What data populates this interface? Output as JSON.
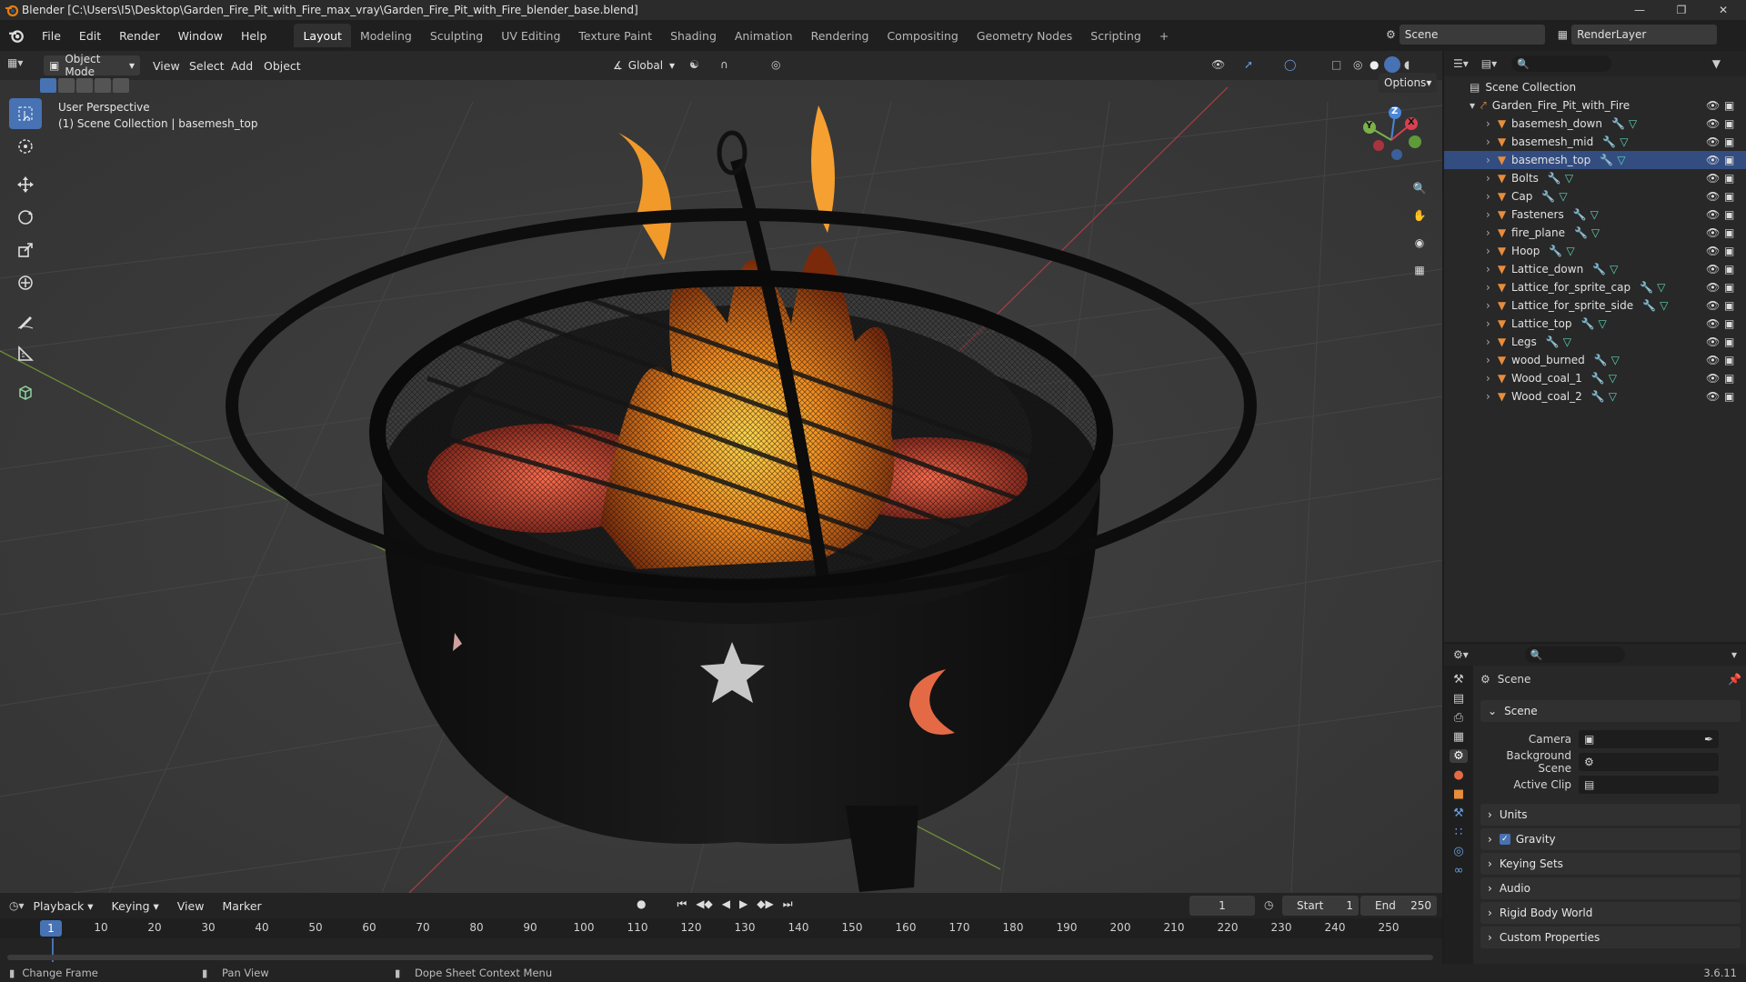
{
  "window": {
    "title": "Blender [C:\\Users\\I5\\Desktop\\Garden_Fire_Pit_with_Fire_max_vray\\Garden_Fire_Pit_with_Fire_blender_base.blend]"
  },
  "menu": [
    "File",
    "Edit",
    "Render",
    "Window",
    "Help"
  ],
  "workspaces": [
    "Layout",
    "Modeling",
    "Sculpting",
    "UV Editing",
    "Texture Paint",
    "Shading",
    "Animation",
    "Rendering",
    "Compositing",
    "Geometry Nodes",
    "Scripting"
  ],
  "top_right": {
    "scene": "Scene",
    "render_layer": "RenderLayer"
  },
  "viewport": {
    "mode": "Object Mode",
    "menus": [
      "View",
      "Select",
      "Add",
      "Object"
    ],
    "orientation": "Global",
    "options": "Options",
    "overlay_line1": "User Perspective",
    "overlay_line2": "(1) Scene Collection | basemesh_top",
    "gizmo": {
      "z": "Z",
      "y": "Y",
      "x": "X"
    }
  },
  "outliner": {
    "root": "Scene Collection",
    "collection": "Garden_Fire_Pit_with_Fire",
    "items": [
      "basemesh_down",
      "basemesh_mid",
      "basemesh_top",
      "Bolts",
      "Cap",
      "Fasteners",
      "fire_plane",
      "Hoop",
      "Lattice_down",
      "Lattice_for_sprite_cap",
      "Lattice_for_sprite_side",
      "Lattice_top",
      "Legs",
      "wood_burned",
      "Wood_coal_1",
      "Wood_coal_2"
    ],
    "selected": "basemesh_top"
  },
  "properties": {
    "context": "Scene",
    "panel": "Scene",
    "camera_label": "Camera",
    "bg_scene_label": "Background Scene",
    "active_clip_label": "Active Clip",
    "sections": [
      "Units",
      "Gravity",
      "Keying Sets",
      "Audio",
      "Rigid Body World",
      "Custom Properties"
    ],
    "gravity_checked": true
  },
  "timeline": {
    "menus": [
      "Playback",
      "Keying",
      "View",
      "Marker"
    ],
    "current_frame": "1",
    "start_label": "Start",
    "start": "1",
    "end_label": "End",
    "end": "250",
    "ticks": [
      "10",
      "20",
      "30",
      "40",
      "50",
      "60",
      "70",
      "80",
      "90",
      "100",
      "110",
      "120",
      "130",
      "140",
      "150",
      "160",
      "170",
      "180",
      "190",
      "200",
      "210",
      "220",
      "230",
      "240",
      "250"
    ],
    "cursor": "1"
  },
  "status": {
    "left": "Change Frame",
    "mid": "Pan View",
    "right": "Dope Sheet Context Menu",
    "version": "3.6.11"
  },
  "colors": {
    "accent": "#4772b3",
    "mesh_icon": "#e88d3c",
    "mod_icon": "#6a9fe0",
    "data_icon": "#5fd3b6"
  }
}
